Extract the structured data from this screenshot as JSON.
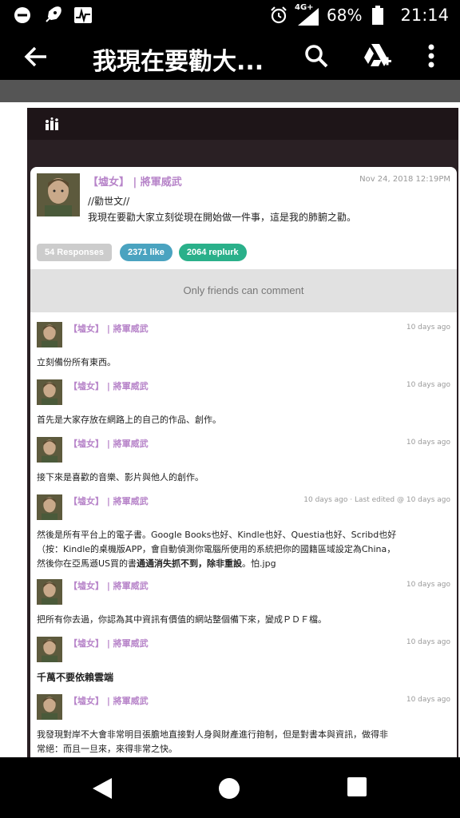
{
  "status_bar": {
    "battery_percent": "68%",
    "time": "21:14",
    "network_label": "4G+"
  },
  "app_bar": {
    "title": "我現在要勸大..."
  },
  "plurk": {
    "author": "【墟女】 | 將軍威武",
    "date": "Nov 24, 2018 12:19PM",
    "content_line1": "//勸世文//",
    "content_line2": "我現在要勸大家立刻從現在開始做一件事，這是我的肺腑之勸。",
    "responses_label": "54 Responses",
    "likes_label": "2371 like",
    "replurks_label": "2064 replurk",
    "only_friends": "Only friends can comment"
  },
  "responses": [
    {
      "author": "【墟女】 | 將軍威武",
      "time": "10 days ago",
      "text": "立刻備份所有東西。"
    },
    {
      "author": "【墟女】 | 將軍威武",
      "time": "10 days ago",
      "text": "首先是大家存放在網路上的自己的作品、創作。"
    },
    {
      "author": "【墟女】 | 將軍威武",
      "time": "10 days ago",
      "text": "接下來是喜歡的音樂、影片與他人的創作。"
    },
    {
      "author": "【墟女】 | 將軍威武",
      "time": "10 days ago · Last edited @ 10 days ago",
      "line1": "然後是所有平台上的電子書。Google Books也好、Kindle也好、Questia也好、Scribd也好",
      "line2": "（按：Kindle的桌機版APP，會自動偵測你電腦所使用的系統把你的國籍區域設定為China，",
      "line3a": "然後你在亞馬遜US買的書",
      "line3b": "通通消失抓不到，除非重設",
      "line3c": "。怕.jpg"
    },
    {
      "author": "【墟女】 | 將軍威武",
      "time": "10 days ago",
      "text": "把所有你去過，你認為其中資訊有價值的網站整個備下來，變成ＰＤＦ檔。"
    },
    {
      "author": "【墟女】 | 將軍威武",
      "time": "10 days ago",
      "text": "千萬不要依賴雲端"
    },
    {
      "author": "【墟女】 | 將軍威武",
      "time": "10 days ago",
      "line1": "我發現對岸不大會非常明目張膽地直接對人身與財產進行箝制，但是對書本與資訊，做得非",
      "line2": "常絕：而且一旦來，來得非常之快。"
    }
  ]
}
